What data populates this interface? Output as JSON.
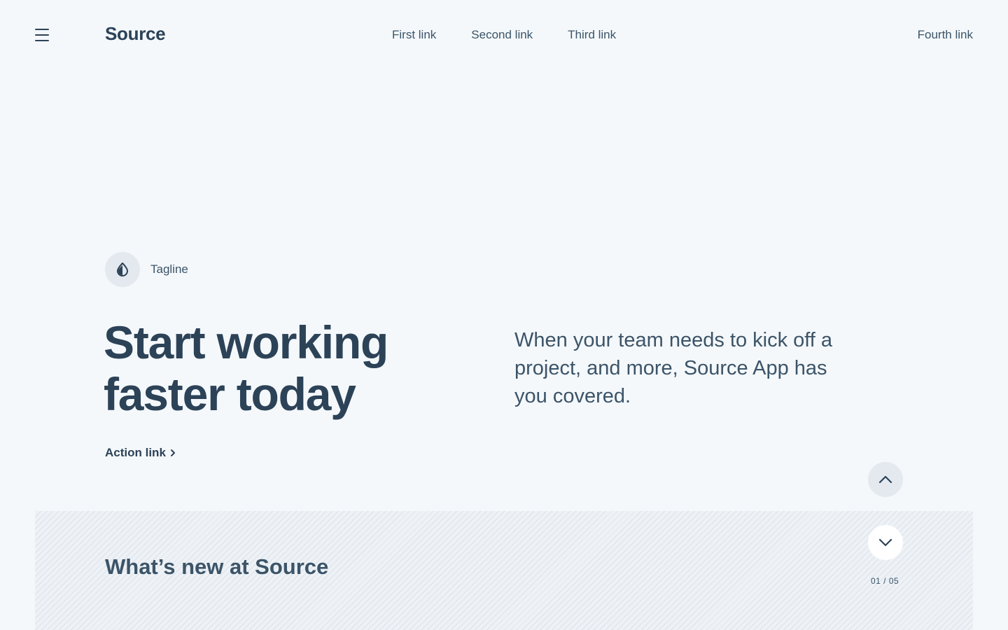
{
  "header": {
    "logo": "Source",
    "nav": [
      "First link",
      "Second link",
      "Third link"
    ],
    "nav_right": "Fourth link"
  },
  "hero": {
    "tagline": "Tagline",
    "headline": "Start working faster today",
    "lead": "When your team needs to kick off a project, and more, Source App has you covered.",
    "action_link": "Action link"
  },
  "news": {
    "title": "What’s new at Source",
    "pager": "01 / 05"
  },
  "icons": {
    "menu": "hamburger-icon",
    "tagline": "contrast-drop-icon",
    "action": "chevron-right-icon",
    "up": "chevron-up-icon",
    "down": "chevron-down-icon"
  },
  "colors": {
    "background": "#f4f8fb",
    "text": "#2c4257",
    "muted_circle": "#e3e9ef"
  }
}
